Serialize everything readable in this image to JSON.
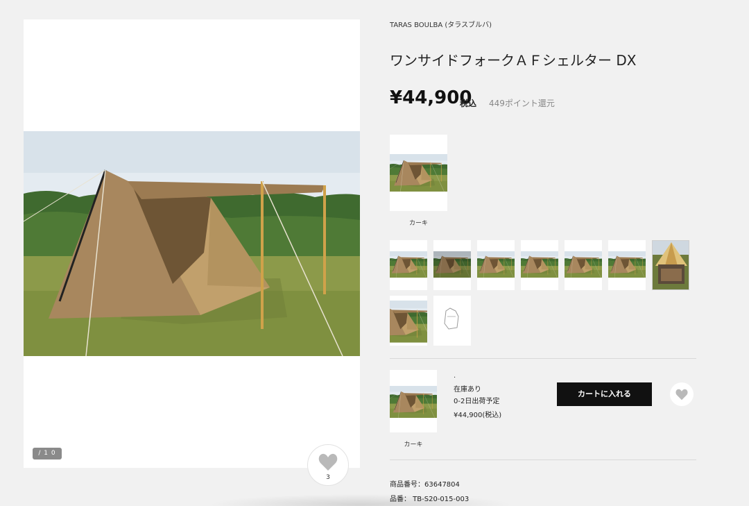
{
  "product": {
    "brand": "TARAS BOULBA (タラスブルバ)",
    "title": "ワンサイドフォークＡＦシェルター DX",
    "price": "¥44,900",
    "tax_label": "税込",
    "points": "449ポイント還元"
  },
  "gallery": {
    "pager": "/ 1 0",
    "favorite_count": "3"
  },
  "color_option": {
    "label": "カーキ"
  },
  "thumbnails": [
    {
      "kind": "tent-front"
    },
    {
      "kind": "tent-dark"
    },
    {
      "kind": "tent-far"
    },
    {
      "kind": "tent-field"
    },
    {
      "kind": "tent-side"
    },
    {
      "kind": "tent-wide"
    },
    {
      "kind": "tent-inside"
    },
    {
      "kind": "tent-closeup"
    },
    {
      "kind": "diagram"
    }
  ],
  "cart": {
    "variant": ".",
    "stock": "在庫あり",
    "shipping": "0-2日出荷予定",
    "price": "¥44,900(税込)",
    "variant_label": "カーキ",
    "button": "カートに入れる"
  },
  "specs": {
    "item_number": "商品番号：63647804",
    "model": "品番：  TB-S20-015-003"
  },
  "colors": {
    "tent": "#a8875e",
    "grass": "#8a9a45",
    "button": "#111111"
  }
}
